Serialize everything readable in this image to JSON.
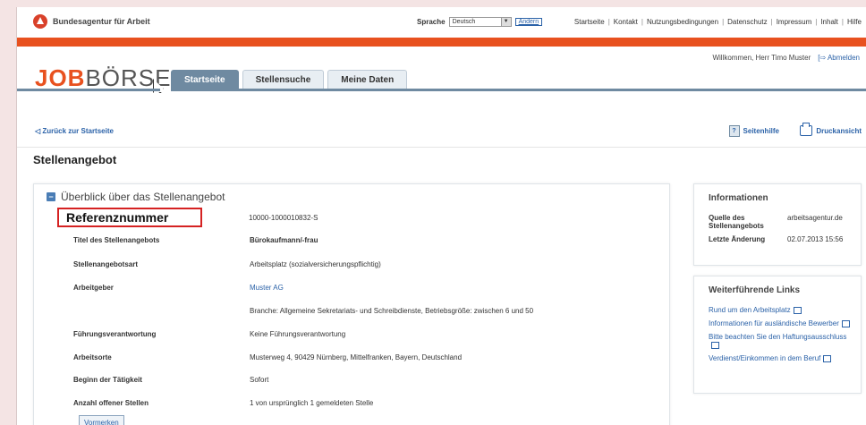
{
  "header": {
    "agency_name": "Bundesagentur für Arbeit",
    "language_label": "Sprache",
    "language_value": "Deutsch",
    "language_button": "Ändern",
    "links": [
      "Startseite",
      "Kontakt",
      "Nutzungsbedingungen",
      "Datenschutz",
      "Impressum",
      "Inhalt",
      "Hilfe"
    ],
    "welcome": "Willkommen, Herr Timo Muster",
    "logout": "Abmelden"
  },
  "brand": {
    "job": "JOB",
    "boerse": "BÖRSE"
  },
  "tabs": [
    {
      "label": "Startseite",
      "active": true
    },
    {
      "label": "Stellensuche",
      "active": false
    },
    {
      "label": "Meine Daten",
      "active": false
    }
  ],
  "subbar": {
    "back": "Zurück zur Startseite",
    "help": "Seitenhilfe",
    "print": "Druckansicht"
  },
  "page_title": "Stellenangebot",
  "overview": {
    "title": "Überblick über das Stellenangebot",
    "ref_label": "Referenznummer",
    "ref_value": "10000-1000010832-S",
    "rows": [
      {
        "label": "Titel des Stellenangebots",
        "value": "Bürokaufmann/-frau"
      },
      {
        "label": "Stellenangebotsart",
        "value": "Arbeitsplatz (sozialversicherungspflichtig)"
      },
      {
        "label": "Arbeitgeber",
        "value": "Muster AG"
      },
      {
        "label": "",
        "value": "Branche: Allgemeine Sekretariats- und Schreibdienste, Betriebsgröße: zwischen 6 und 50"
      },
      {
        "label": "Führungsverantwortung",
        "value": "Keine Führungsverantwortung"
      },
      {
        "label": "Arbeitsorte",
        "value": "Musterweg 4, 90429 Nürnberg, Mittelfranken, Bayern, Deutschland"
      },
      {
        "label": "Beginn der Tätigkeit",
        "value": "Sofort"
      },
      {
        "label": "Anzahl offener Stellen",
        "value": "1 von ursprünglich 1 gemeldeten Stelle"
      }
    ],
    "bookmark_button": "Vormerken"
  },
  "sidebar": {
    "info_title": "Informationen",
    "source_label": "Quelle des Stellenangebots",
    "source_value": "arbeitsagentur.de",
    "changed_label": "Letzte Änderung",
    "changed_value": "02.07.2013 15:56",
    "links_title": "Weiterführende Links",
    "links": [
      "Rund um den Arbeitsplatz",
      "Informationen für ausländische Bewerber",
      "Bitte beachten Sie den Haftungsausschluss",
      "Verdienst/Einkommen in dem Beruf"
    ]
  },
  "colors": {
    "accent": "#e8511f",
    "tab_active": "#6f8aa1",
    "link": "#2b62a8",
    "highlight": "#d52222"
  }
}
